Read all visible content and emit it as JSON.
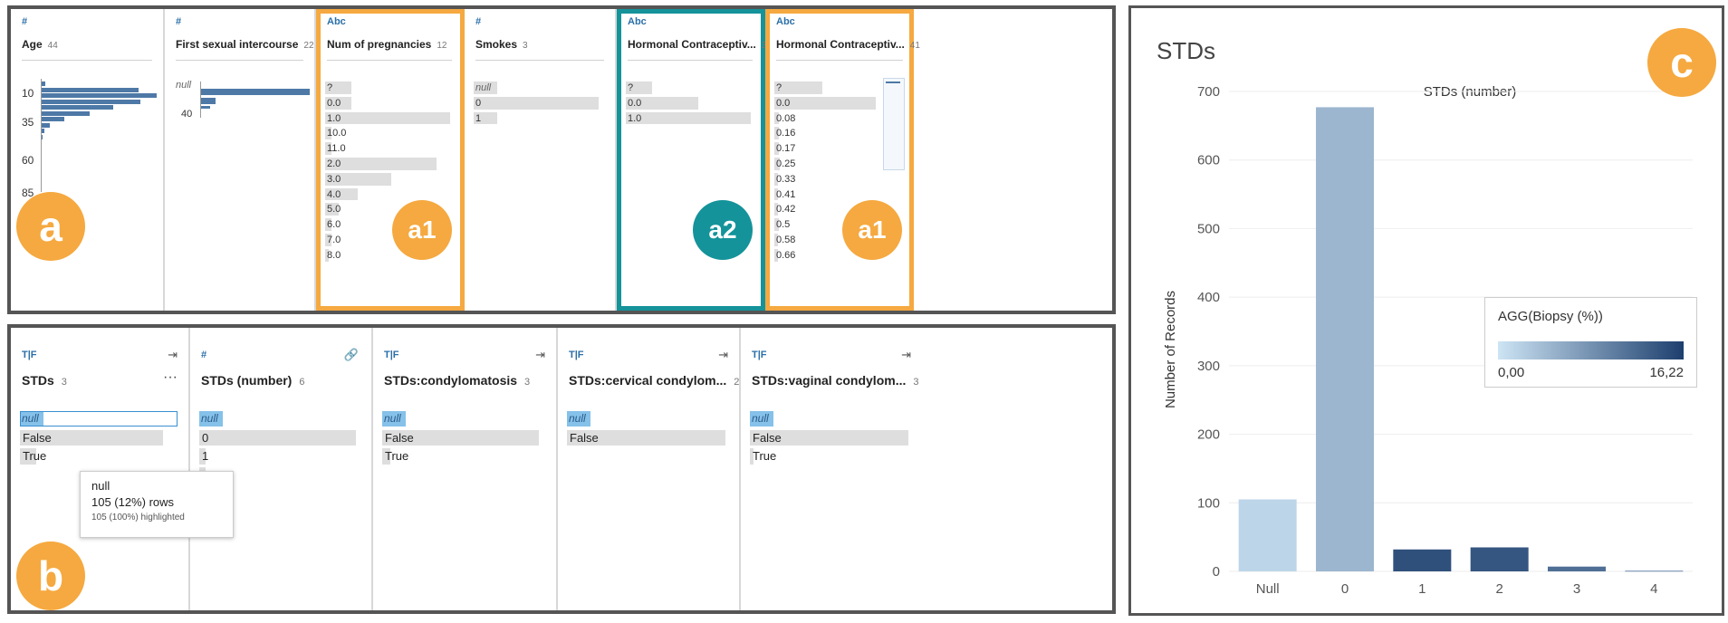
{
  "panel_a": {
    "badge": "a",
    "columns": [
      {
        "type": "#",
        "title": "Age",
        "count": "44",
        "axis": [
          "10",
          "35",
          "60",
          "85"
        ]
      },
      {
        "type": "#",
        "title": "First sexual intercourse",
        "count": "22",
        "null_label": "null",
        "axis_label": "40"
      },
      {
        "type": "Abc",
        "title": "Num of pregnancies",
        "count": "12",
        "badge": "a1",
        "items": [
          "?",
          "0.0",
          "1.0",
          "10.0",
          "11.0",
          "2.0",
          "3.0",
          "4.0",
          "5.0",
          "6.0",
          "7.0",
          "8.0"
        ],
        "levels": [
          0.2,
          0.2,
          0.95,
          0.05,
          0.05,
          0.85,
          0.5,
          0.25,
          0.1,
          0.05,
          0.05,
          0.03
        ]
      },
      {
        "type": "#",
        "title": "Smokes",
        "count": "3",
        "items": [
          "null",
          "0",
          "1"
        ],
        "levels": [
          0.18,
          0.95,
          0.18
        ]
      },
      {
        "type": "Abc",
        "title": "Hormonal Contraceptiv...",
        "count": "3",
        "badge": "a2",
        "items": [
          "?",
          "0.0",
          "1.0"
        ],
        "levels": [
          0.2,
          0.55,
          0.95
        ]
      },
      {
        "type": "Abc",
        "title": "Hormonal Contraceptiv...",
        "count": "41",
        "badge": "a1",
        "items": [
          "?",
          "0.0",
          "0.08",
          "0.16",
          "0.17",
          "0.25",
          "0.33",
          "0.41",
          "0.42",
          "0.5",
          "0.58",
          "0.66"
        ],
        "levels": [
          0.45,
          0.95,
          0.04,
          0.04,
          0.04,
          0.05,
          0.03,
          0.03,
          0.03,
          0.04,
          0.03,
          0.03
        ]
      }
    ]
  },
  "panel_b": {
    "badge": "b",
    "columns": [
      {
        "type": "T|F",
        "title": "STDs",
        "count": "3",
        "menu": "···",
        "items": [
          "null",
          "False",
          "True"
        ],
        "levels": [
          0.12,
          0.9,
          0.1
        ]
      },
      {
        "type": "#",
        "title": "STDs (number)",
        "count": "6",
        "items": [
          "null",
          "0",
          "1",
          "2",
          "3",
          "4"
        ],
        "levels": [
          0.13,
          0.96,
          0.04,
          0.04,
          0.01,
          0.01
        ]
      },
      {
        "type": "T|F",
        "title": "STDs:condylomatosis",
        "count": "3",
        "items": [
          "null",
          "False",
          "True"
        ],
        "levels": [
          0.13,
          0.96,
          0.05
        ]
      },
      {
        "type": "T|F",
        "title": "STDs:cervical condylom...",
        "count": "2",
        "items": [
          "null",
          "False"
        ],
        "levels": [
          0.13,
          0.97
        ]
      },
      {
        "type": "T|F",
        "title": "STDs:vaginal condylom...",
        "count": "3",
        "items": [
          "null",
          "False",
          "True"
        ],
        "levels": [
          0.13,
          0.97,
          0.01
        ]
      }
    ],
    "tooltip": {
      "title": "null",
      "rows": "105 (12%) rows",
      "highlighted": "105 (100%) highlighted"
    }
  },
  "panel_c": {
    "badge": "c",
    "sheet_title": "STDs",
    "legend": {
      "title": "AGG(Biopsy (%))",
      "min": "0,00",
      "max": "16,22"
    },
    "chart_data": {
      "type": "bar",
      "title": "STDs (number)",
      "xlabel": "",
      "ylabel": "Number of Records",
      "categories": [
        "Null",
        "0",
        "1",
        "2",
        "3",
        "4"
      ],
      "values": [
        105,
        677,
        32,
        35,
        7,
        1
      ],
      "color_values": [
        1.5,
        4.5,
        14.5,
        14.0,
        11.5,
        9.0
      ],
      "color_range": [
        0,
        16.22
      ],
      "ylim": [
        0,
        700
      ],
      "yticks": [
        0,
        100,
        200,
        300,
        400,
        500,
        600,
        700
      ],
      "grid": true
    }
  }
}
